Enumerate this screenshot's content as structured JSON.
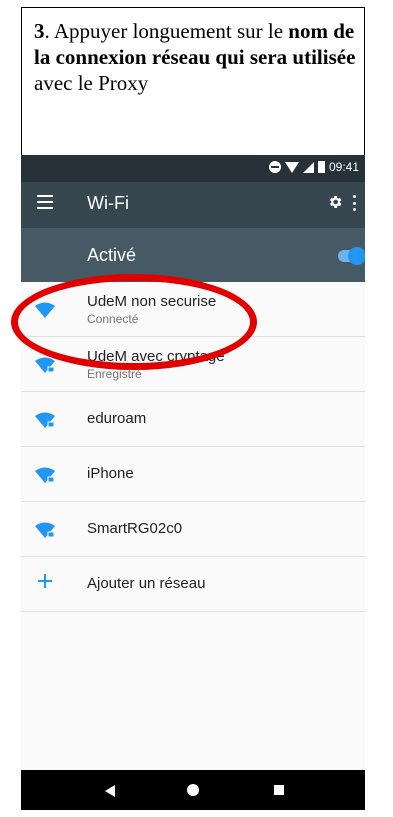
{
  "instruction": {
    "step": "3",
    "part1": ". Appuyer longuement sur le ",
    "bold": "nom de la connexion réseau qui sera utilisée",
    "part2": " avec le Proxy"
  },
  "status_bar": {
    "time": "09:41"
  },
  "app_bar": {
    "title": "Wi-Fi",
    "icons": [
      "menu-icon",
      "gear-icon",
      "more-vert-icon"
    ]
  },
  "wifi_switch": {
    "label": "Activé",
    "on": true
  },
  "networks": [
    {
      "name": "UdeM non securise",
      "status": "Connecté",
      "icon": "wifi-icon"
    },
    {
      "name": "UdeM avec cryptage",
      "status": "Enregistré",
      "icon": "wifi-locked-icon"
    },
    {
      "name": "eduroam",
      "icon": "wifi-locked-icon"
    },
    {
      "name": "iPhone",
      "icon": "wifi-locked-icon"
    },
    {
      "name": "SmartRG02c0",
      "icon": "wifi-locked-icon"
    }
  ],
  "add_network": {
    "label": "Ajouter un réseau",
    "icon": "plus-icon"
  },
  "colors": {
    "accent": "#2196f3",
    "app_bar": "#37474f",
    "switch_bar": "#455a64",
    "status_bar": "#263238",
    "highlight": "#e00000"
  }
}
